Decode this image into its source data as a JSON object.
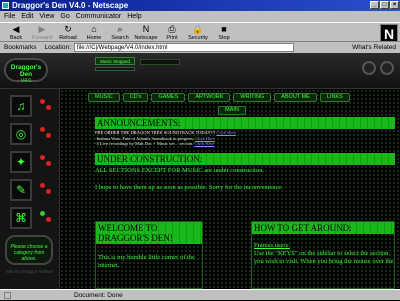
{
  "window": {
    "title": "Draggor's Den V4.0 - Netscape"
  },
  "menu": [
    "File",
    "Edit",
    "View",
    "Go",
    "Communicator",
    "Help"
  ],
  "toolbar": {
    "buttons": [
      {
        "label": "Back",
        "icon": "back-arrow-icon",
        "glyph": "◀"
      },
      {
        "label": "Forward",
        "icon": "forward-arrow-icon",
        "glyph": "▶"
      },
      {
        "label": "Reload",
        "icon": "reload-icon",
        "glyph": "↻"
      },
      {
        "label": "Home",
        "icon": "home-icon",
        "glyph": "⌂"
      },
      {
        "label": "Search",
        "icon": "search-icon",
        "glyph": "⌕"
      },
      {
        "label": "Netscape",
        "icon": "netscape-icon",
        "glyph": "N"
      },
      {
        "label": "Print",
        "icon": "print-icon",
        "glyph": "⎙"
      },
      {
        "label": "Security",
        "icon": "lock-icon",
        "glyph": "🔒"
      },
      {
        "label": "Stop",
        "icon": "stop-icon",
        "glyph": "■"
      }
    ],
    "brand": "N"
  },
  "location": {
    "bookmarks": "Bookmarks",
    "label": "Location:",
    "url": "file:///C|/Webpage/V4.0/index.html",
    "related": "What's Related"
  },
  "site": {
    "logo_line1": "Draggor's Den",
    "logo_line2": "V4.0",
    "music_label": "Music Stopped",
    "hint": "Please choose a category from above.",
    "credit": "Site by Draggor Aeldwn"
  },
  "nav": [
    "MUSIC",
    "CD's",
    "GAMES",
    "ARTWORK",
    "WRITING",
    "ABOUT ME",
    "LINKS"
  ],
  "main_button": "MAIN",
  "announcements": {
    "heading": "ANNOUNCEMENTS:",
    "lines": [
      {
        "text": "PRE ORDER THE DRAGON TREK SOUNDTRACK TODAY!!! ",
        "link": "Click Here"
      },
      {
        "text": "-Indiana Wars: Fate of Atlantis Soundtrack in progress. ",
        "link": "Click Here"
      },
      {
        "text": "-3 Live recordings by Matt Doc + Music sec... section. ",
        "link": "Click Here"
      }
    ]
  },
  "construction": {
    "heading": "UNDER CONSTRUCTION:",
    "p1": "ALL SECTIONS EXCEPT FOR MUSIC are under construction.",
    "p2": "I hope to have them up as soon as possible. Sorry for the inconvenience."
  },
  "welcome": {
    "heading": "WELCOME TO DRAGGOR'S DEN!",
    "body": "This is my humble little corner of the internet."
  },
  "howto": {
    "heading": "HOW TO GET AROUND:",
    "sub": "Frames users:",
    "body": "Use the \"KEYS\" on the sidebar to select the section you wish to visit. When you bring the mouse over the"
  },
  "status": {
    "text": "Document: Done"
  },
  "colors": {
    "accent": "#3cff3c",
    "heading_bg": "#1ab81a",
    "link": "#8888ff"
  }
}
